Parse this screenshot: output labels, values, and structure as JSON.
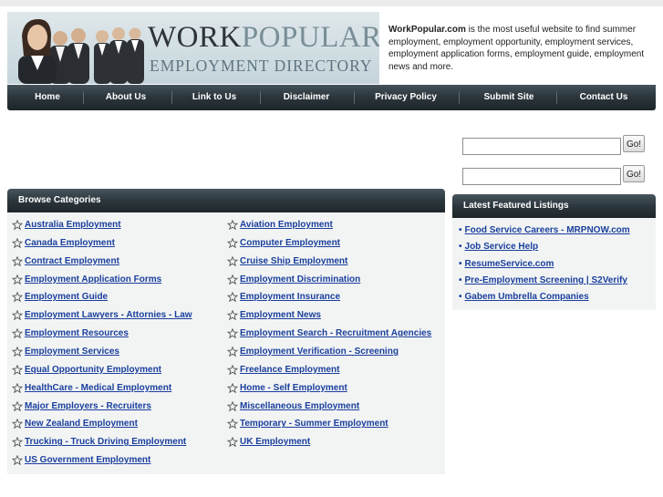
{
  "header": {
    "logo_word1": "WORK",
    "logo_word2": "POPULAR",
    "logo_subtitle": "EMPLOYMENT DIRECTORY",
    "intro_site": "WorkPopular.com",
    "intro_text": " is the most useful website to find summer employment, employment opportunity, employment services, employment application forms, employment guide, employment news and more."
  },
  "nav": [
    {
      "label": "Home"
    },
    {
      "label": "About Us"
    },
    {
      "label": "Link to Us"
    },
    {
      "label": "Disclaimer"
    },
    {
      "label": "Privacy Policy"
    },
    {
      "label": "Submit Site"
    },
    {
      "label": "Contact Us"
    }
  ],
  "search": {
    "box1": {
      "value": "",
      "button": "Go!"
    },
    "box2": {
      "value": "",
      "button": "Go!"
    }
  },
  "categories": {
    "title": "Browse Categories",
    "left": [
      "Australia Employment",
      "Canada Employment",
      "Contract Employment",
      "Employment Application Forms",
      "Employment Guide",
      "Employment Lawyers - Attornies - Law",
      "Employment Resources",
      "Employment Services",
      "Equal Opportunity Employment",
      "HealthCare - Medical Employment",
      "Major Employers - Recruiters",
      "New Zealand Employment",
      "Trucking - Truck Driving Employment",
      "US Government Employment"
    ],
    "right": [
      "Aviation Employment",
      "Computer Employment",
      "Cruise Ship Employment",
      "Employment Discrimination",
      "Employment Insurance",
      "Employment News",
      "Employment Search - Recruitment Agencies",
      "Employment Verification - Screening",
      "Freelance Employment",
      "Home - Self Employment",
      "Miscellaneous Employment",
      "Temporary - Summer Employment",
      "UK Employment"
    ]
  },
  "featured": {
    "title": "Latest Featured Listings",
    "bullet": "•",
    "items": [
      "Food Service Careers - MRPNOW.com",
      "Job Service Help",
      "ResumeService.com",
      "Pre-Employment Screening | S2Verify",
      "Gabem Umbrella Companies"
    ]
  },
  "colors": {
    "link": "#1a3f9c",
    "nav_bg": "#2c373d",
    "panel_bg": "#f2f4f4"
  },
  "icons": {
    "category": "star-outline-icon"
  }
}
